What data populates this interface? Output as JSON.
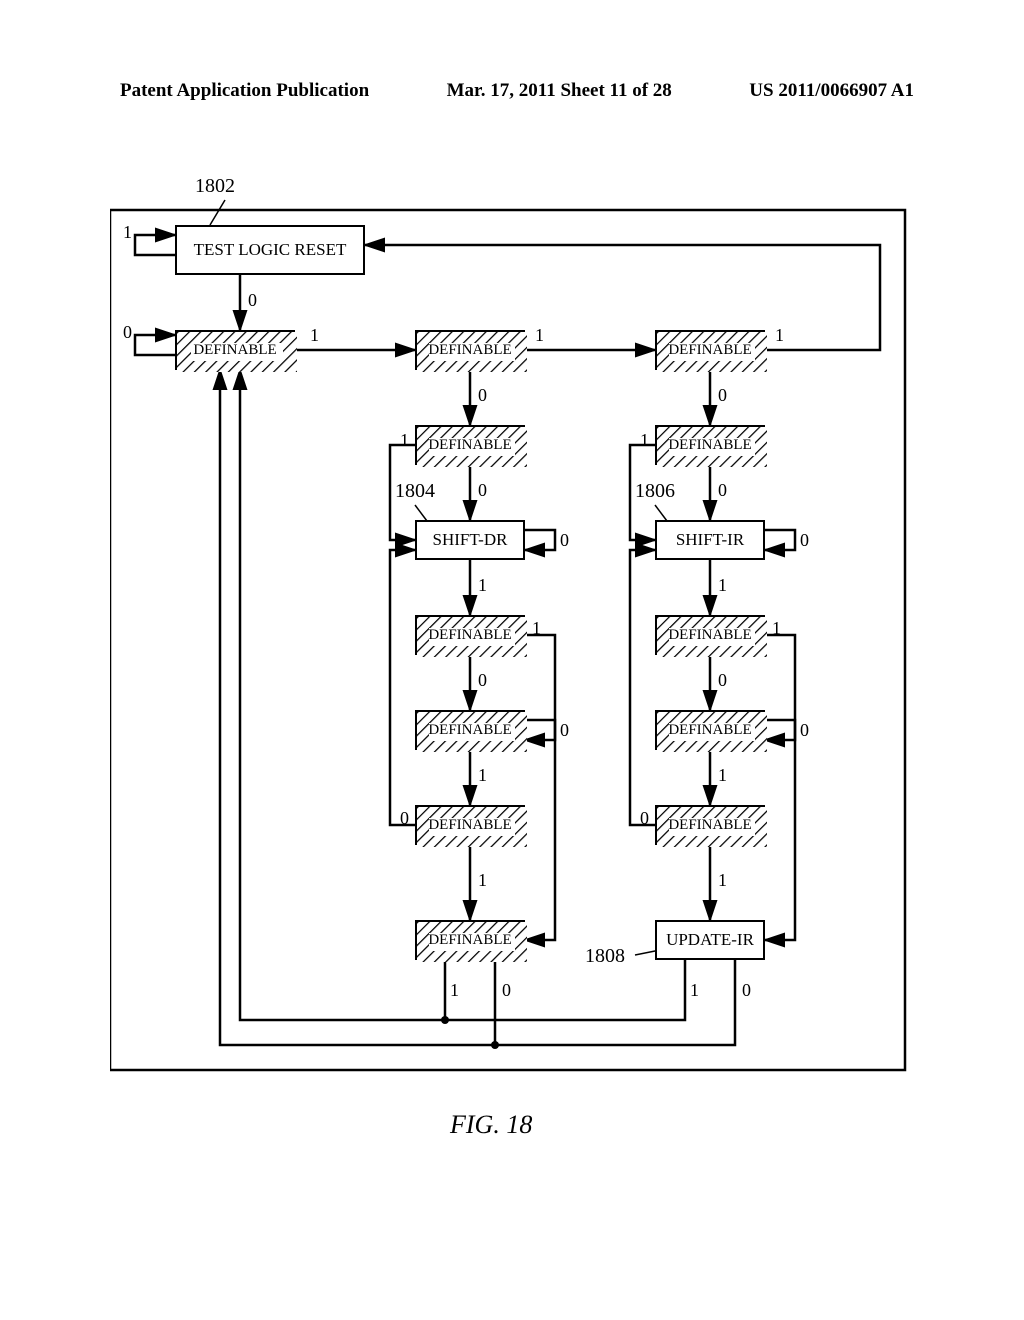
{
  "header": {
    "left": "Patent Application Publication",
    "mid": "Mar. 17, 2011  Sheet 11 of 28",
    "right": "US 2011/0066907 A1"
  },
  "labels": {
    "tlr": "TEST LOGIC RESET",
    "def": "DEFINABLE",
    "shiftdr": "SHIFT-DR",
    "shiftir": "SHIFT-IR",
    "updateir": "UPDATE-IR"
  },
  "refs": {
    "r1802": "1802",
    "r1804": "1804",
    "r1806": "1806",
    "r1808": "1808"
  },
  "fig": "FIG. 18",
  "d0": "0",
  "d1": "1",
  "chart_data": {
    "type": "diagram",
    "description": "JTAG TAP controller state diagram (FSM) with some states replaced by DEFINABLE placeholders",
    "states": [
      {
        "id": "TLR",
        "label": "TEST LOGIC RESET",
        "ref": "1802",
        "hatched": false
      },
      {
        "id": "RTI",
        "label": "DEFINABLE",
        "hatched": true
      },
      {
        "id": "SelDR",
        "label": "DEFINABLE",
        "hatched": true
      },
      {
        "id": "SelIR",
        "label": "DEFINABLE",
        "hatched": true
      },
      {
        "id": "CapDR",
        "label": "DEFINABLE",
        "hatched": true
      },
      {
        "id": "CapIR",
        "label": "DEFINABLE",
        "hatched": true
      },
      {
        "id": "ShDR",
        "label": "SHIFT-DR",
        "ref": "1804",
        "hatched": false
      },
      {
        "id": "ShIR",
        "label": "SHIFT-IR",
        "ref": "1806",
        "hatched": false
      },
      {
        "id": "Ex1DR",
        "label": "DEFINABLE",
        "hatched": true
      },
      {
        "id": "Ex1IR",
        "label": "DEFINABLE",
        "hatched": true
      },
      {
        "id": "PaDR",
        "label": "DEFINABLE",
        "hatched": true
      },
      {
        "id": "PaIR",
        "label": "DEFINABLE",
        "hatched": true
      },
      {
        "id": "Ex2DR",
        "label": "DEFINABLE",
        "hatched": true
      },
      {
        "id": "Ex2IR",
        "label": "DEFINABLE",
        "hatched": true
      },
      {
        "id": "UpDR",
        "label": "DEFINABLE",
        "hatched": true
      },
      {
        "id": "UpIR",
        "label": "UPDATE-IR",
        "ref": "1808",
        "hatched": false
      }
    ],
    "transitions": [
      {
        "from": "TLR",
        "tms": 1,
        "to": "TLR"
      },
      {
        "from": "TLR",
        "tms": 0,
        "to": "RTI"
      },
      {
        "from": "RTI",
        "tms": 0,
        "to": "RTI"
      },
      {
        "from": "RTI",
        "tms": 1,
        "to": "SelDR"
      },
      {
        "from": "SelDR",
        "tms": 1,
        "to": "SelIR"
      },
      {
        "from": "SelDR",
        "tms": 0,
        "to": "CapDR"
      },
      {
        "from": "SelIR",
        "tms": 1,
        "to": "TLR"
      },
      {
        "from": "SelIR",
        "tms": 0,
        "to": "CapIR"
      },
      {
        "from": "CapDR",
        "tms": 0,
        "to": "ShDR"
      },
      {
        "from": "CapDR",
        "tms": 1,
        "to": "Ex1DR"
      },
      {
        "from": "CapIR",
        "tms": 0,
        "to": "ShIR"
      },
      {
        "from": "CapIR",
        "tms": 1,
        "to": "Ex1IR"
      },
      {
        "from": "ShDR",
        "tms": 0,
        "to": "ShDR"
      },
      {
        "from": "ShDR",
        "tms": 1,
        "to": "Ex1DR"
      },
      {
        "from": "ShIR",
        "tms": 0,
        "to": "ShIR"
      },
      {
        "from": "ShIR",
        "tms": 1,
        "to": "Ex1IR"
      },
      {
        "from": "Ex1DR",
        "tms": 0,
        "to": "PaDR"
      },
      {
        "from": "Ex1DR",
        "tms": 1,
        "to": "UpDR"
      },
      {
        "from": "Ex1IR",
        "tms": 0,
        "to": "PaIR"
      },
      {
        "from": "Ex1IR",
        "tms": 1,
        "to": "UpIR"
      },
      {
        "from": "PaDR",
        "tms": 0,
        "to": "PaDR"
      },
      {
        "from": "PaDR",
        "tms": 1,
        "to": "Ex2DR"
      },
      {
        "from": "PaIR",
        "tms": 0,
        "to": "PaIR"
      },
      {
        "from": "PaIR",
        "tms": 1,
        "to": "Ex2IR"
      },
      {
        "from": "Ex2DR",
        "tms": 0,
        "to": "ShDR"
      },
      {
        "from": "Ex2DR",
        "tms": 1,
        "to": "UpDR"
      },
      {
        "from": "Ex2IR",
        "tms": 0,
        "to": "ShIR"
      },
      {
        "from": "Ex2IR",
        "tms": 1,
        "to": "UpIR"
      },
      {
        "from": "UpDR",
        "tms": 0,
        "to": "RTI"
      },
      {
        "from": "UpDR",
        "tms": 1,
        "to": "SelDR"
      },
      {
        "from": "UpIR",
        "tms": 0,
        "to": "RTI"
      },
      {
        "from": "UpIR",
        "tms": 1,
        "to": "SelDR"
      }
    ]
  }
}
